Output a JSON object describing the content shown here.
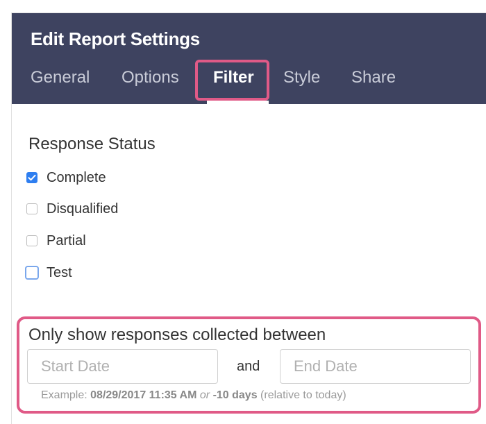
{
  "header": {
    "title": "Edit Report Settings",
    "tabs": {
      "general": "General",
      "options": "Options",
      "filter": "Filter",
      "style": "Style",
      "share": "Share"
    },
    "active_tab": "Filter"
  },
  "response_status": {
    "title": "Response Status",
    "options": [
      {
        "label": "Complete",
        "checked": true
      },
      {
        "label": "Disqualified",
        "checked": false
      },
      {
        "label": "Partial",
        "checked": false
      },
      {
        "label": "Test",
        "checked": false
      }
    ]
  },
  "date_filter": {
    "title": "Only show responses collected between",
    "start_placeholder": "Start Date",
    "end_placeholder": "End Date",
    "and_label": "and",
    "example": {
      "prefix": "Example: ",
      "date": "08/29/2017 11:35 AM",
      "or": " or ",
      "relative": "-10 days",
      "suffix": " (relative to today)"
    }
  },
  "colors": {
    "header_bg": "#3e4360",
    "highlight": "#e05a87",
    "checkbox_checked": "#2e7ef0"
  }
}
